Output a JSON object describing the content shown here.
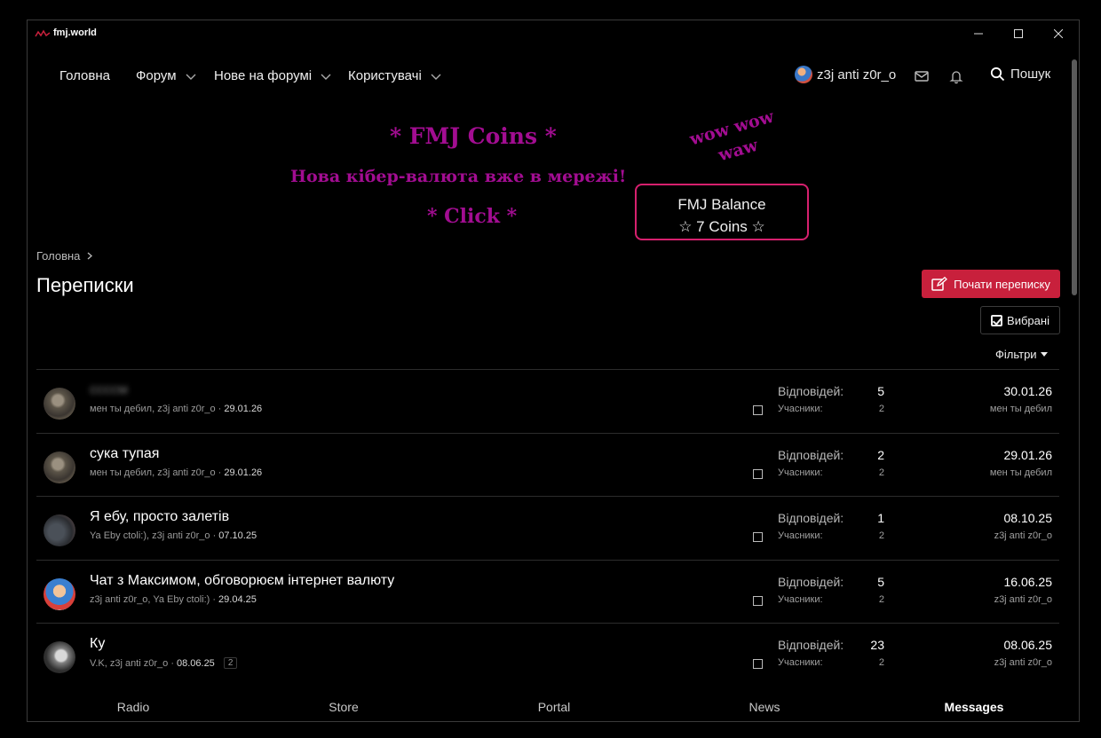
{
  "window": {
    "title": "fmj.world"
  },
  "nav": {
    "home": "Головна",
    "forum": "Форум",
    "new_on_forum": "Нове на форумі",
    "users": "Користувачі",
    "username": "z3j anti z0r_o",
    "search": "Пошук"
  },
  "banner": {
    "title": "* FMJ Coins *",
    "subtitle": "Нова кібер-валюта вже в мережі!",
    "click": "* Click *",
    "wow_line1": "wow wow",
    "wow_line2": "waw",
    "balance_label": "FMJ Balance",
    "balance_value": "☆ 7 Coins ☆"
  },
  "breadcrumb": {
    "home": "Головна"
  },
  "page": {
    "title": "Переписки",
    "start_button": "Почати переписку",
    "favorites_button": "Вибрані",
    "filters": "Фільтри"
  },
  "labels": {
    "replies": "Відповідей:",
    "participants": "Учасники:"
  },
  "conversations": [
    {
      "title": "ссссм",
      "blurred": true,
      "participants_text": "мен ты дебил, z3j anti z0r_o ·",
      "date": "29.01.26",
      "page_badge": "",
      "replies": "5",
      "participants": "2",
      "last_date": "30.01.26",
      "last_user": "мен ты дебил"
    },
    {
      "title": "сука тупая",
      "blurred": false,
      "participants_text": "мен ты дебил, z3j anti z0r_o ·",
      "date": "29.01.26",
      "page_badge": "",
      "replies": "2",
      "participants": "2",
      "last_date": "29.01.26",
      "last_user": "мен ты дебил"
    },
    {
      "title": "Я ебу, просто залетів",
      "blurred": false,
      "participants_text": "Ya Eby ctoli:), z3j anti z0r_o ·",
      "date": "07.10.25",
      "page_badge": "",
      "replies": "1",
      "participants": "2",
      "last_date": "08.10.25",
      "last_user": "z3j anti z0r_o"
    },
    {
      "title": "Чат з Максимом, обговорюєм інтернет валюту",
      "blurred": false,
      "participants_text": "z3j anti z0r_o, Ya Eby ctoli:) ·",
      "date": "29.04.25",
      "page_badge": "",
      "replies": "5",
      "participants": "2",
      "last_date": "16.06.25",
      "last_user": "z3j anti z0r_o"
    },
    {
      "title": "Ку",
      "blurred": false,
      "participants_text": "V.K, z3j anti z0r_o ·",
      "date": "08.06.25",
      "page_badge": "2",
      "replies": "23",
      "participants": "2",
      "last_date": "08.06.25",
      "last_user": "z3j anti z0r_o"
    }
  ],
  "bottom_tabs": [
    {
      "label": "Radio",
      "active": false
    },
    {
      "label": "Store",
      "active": false
    },
    {
      "label": "Portal",
      "active": false
    },
    {
      "label": "News",
      "active": false
    },
    {
      "label": "Messages",
      "active": true
    }
  ],
  "colors": {
    "accent": "#c8203c",
    "banner_text": "#a20d91",
    "balance_border": "#d6206e"
  }
}
